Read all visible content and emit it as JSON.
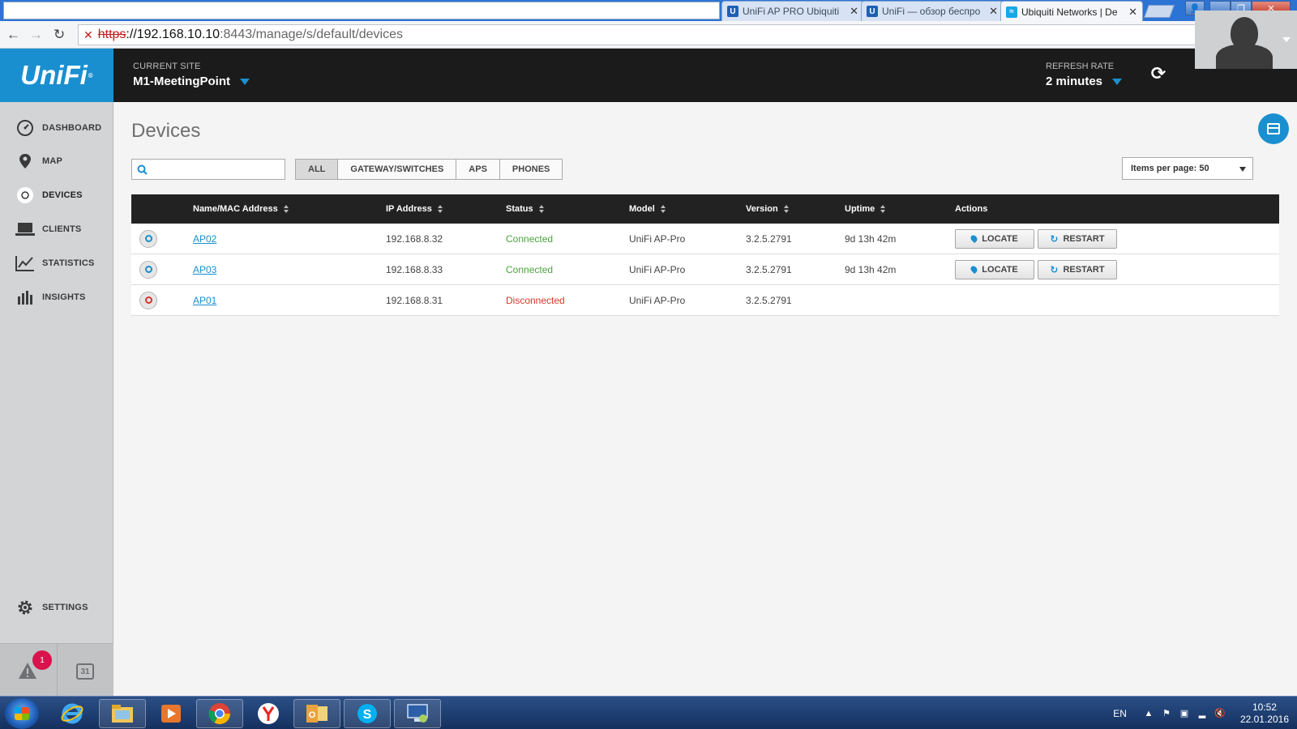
{
  "browser": {
    "tabs": [
      {
        "title": "UniFi AP PRO Ubiquiti",
        "favicon": "unifi-u-icon"
      },
      {
        "title": "UniFi — обзор беспро",
        "favicon": "unifi-u-icon"
      },
      {
        "title": "Ubiquiti Networks | De",
        "favicon": "wifi-icon",
        "active": true
      }
    ],
    "url": {
      "scheme": "https",
      "host": "://192.168.10.10",
      "rest": ":8443/manage/s/default/devices"
    }
  },
  "header": {
    "logo_text": "UniFi",
    "logo_mark": "®",
    "site_label": "CURRENT SITE",
    "site_value": "M1-MeetingPoint",
    "refresh_label": "REFRESH RATE",
    "refresh_value": "2 minutes"
  },
  "sidebar": {
    "items": [
      {
        "label": "DASHBOARD",
        "icon": "dashboard-gauge-icon"
      },
      {
        "label": "MAP",
        "icon": "map-pin-icon"
      },
      {
        "label": "DEVICES",
        "icon": "devices-circle-icon",
        "active": true
      },
      {
        "label": "CLIENTS",
        "icon": "laptop-icon"
      },
      {
        "label": "STATISTICS",
        "icon": "line-chart-icon"
      },
      {
        "label": "INSIGHTS",
        "icon": "bar-chart-icon"
      }
    ],
    "settings_label": "SETTINGS",
    "alert_count": "1",
    "calendar_day": "31"
  },
  "main": {
    "title": "Devices",
    "filters": [
      "ALL",
      "GATEWAY/SWITCHES",
      "APS",
      "PHONES"
    ],
    "active_filter": "ALL",
    "items_per_page": "Items per page: 50",
    "columns": [
      "Name/MAC Address",
      "IP Address",
      "Status",
      "Model",
      "Version",
      "Uptime",
      "Actions"
    ],
    "rows": [
      {
        "name": "AP02",
        "ip": "192.168.8.32",
        "status": "Connected",
        "model": "UniFi AP-Pro",
        "version": "3.2.5.2791",
        "uptime": "9d 13h 42m",
        "locate": "LOCATE",
        "restart": "RESTART"
      },
      {
        "name": "AP03",
        "ip": "192.168.8.33",
        "status": "Connected",
        "model": "UniFi AP-Pro",
        "version": "3.2.5.2791",
        "uptime": "9d 13h 42m",
        "locate": "LOCATE",
        "restart": "RESTART"
      },
      {
        "name": "AP01",
        "ip": "192.168.8.31",
        "status": "Disconnected",
        "model": "UniFi AP-Pro",
        "version": "3.2.5.2791",
        "uptime": "",
        "locate": "",
        "restart": ""
      }
    ]
  },
  "taskbar": {
    "lang": "EN",
    "time": "10:52",
    "date": "22.01.2016"
  },
  "colors": {
    "accent": "#1a8fd0",
    "connected": "#49a53a",
    "disconnected": "#d9342b",
    "badge": "#d9134d"
  }
}
